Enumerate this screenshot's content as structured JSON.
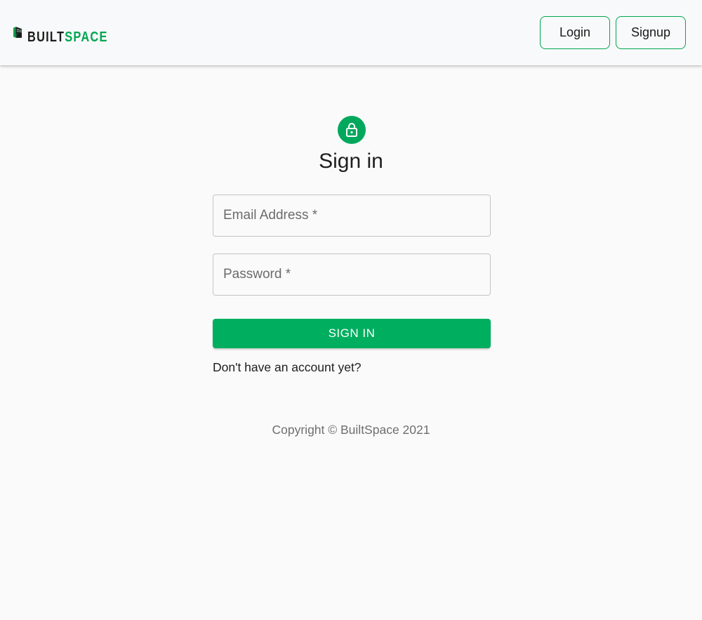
{
  "header": {
    "brand": {
      "part1": "BUILT",
      "part2": "SPACE"
    },
    "login_label": "Login",
    "signup_label": "Signup"
  },
  "main": {
    "icon": "lock-icon",
    "title": "Sign in",
    "email_placeholder": "Email Address *",
    "password_placeholder": "Password *",
    "submit_label": "SIGN IN",
    "signup_prompt": "Don't have an account yet?"
  },
  "footer": {
    "copyright": "Copyright © BuiltSpace 2021"
  },
  "colors": {
    "accent": "#00a651",
    "button": "#00ae5f",
    "avatar": "#00a85d",
    "header_bg": "#f8f9fa",
    "page_bg": "#fafafa"
  }
}
